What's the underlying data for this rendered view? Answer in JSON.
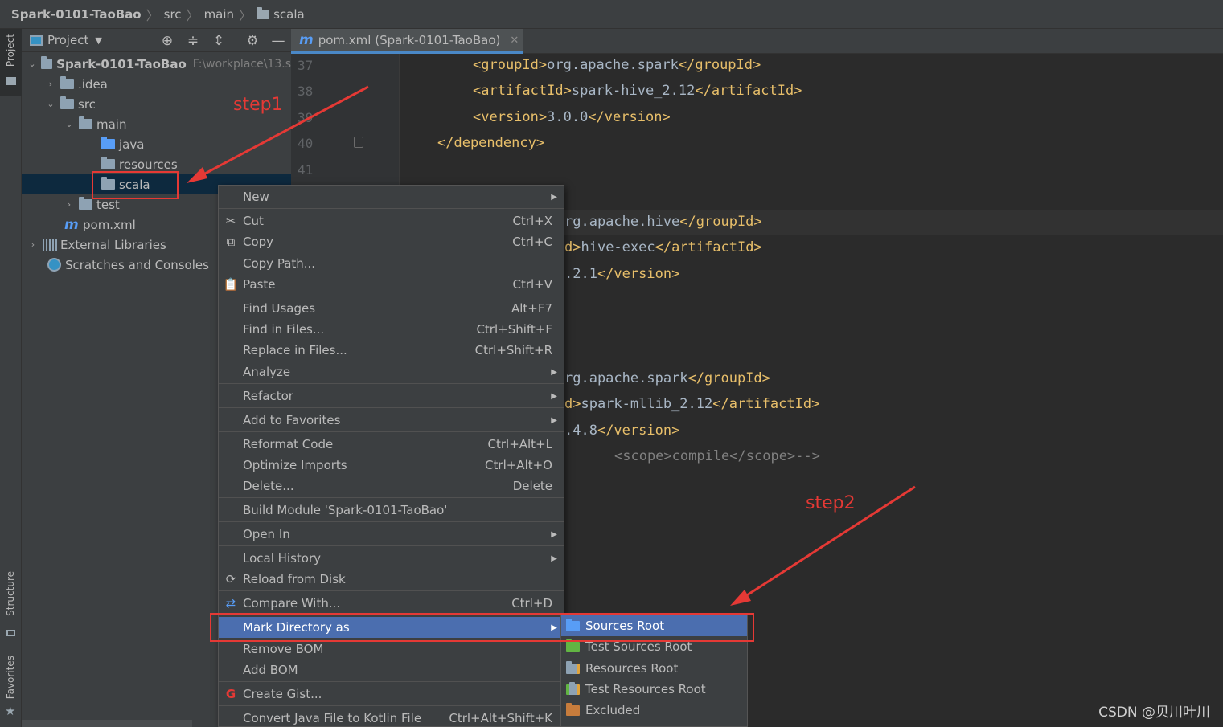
{
  "breadcrumb": {
    "project": "Spark-0101-TaoBao",
    "src": "src",
    "main": "main",
    "scala": "scala"
  },
  "stripe": {
    "project": "Project",
    "structure": "Structure",
    "favorites": "Favorites"
  },
  "project_panel": {
    "title": "Project",
    "tree": {
      "root": "Spark-0101-TaoBao",
      "root_path": "F:\\workplace\\13.s",
      "idea": ".idea",
      "src": "src",
      "main": "main",
      "java": "java",
      "resources": "resources",
      "scala": "scala",
      "test": "test",
      "pom": "pom.xml",
      "external_libraries": "External Libraries",
      "scratches": "Scratches and Consoles"
    }
  },
  "editor": {
    "tab": "pom.xml (Spark-0101-TaoBao)",
    "line_numbers": [
      "37",
      "38",
      "39",
      "40",
      "41"
    ],
    "code": {
      "l1_open": "<groupId>",
      "l1_val": "org.apache.spark",
      "l1_close": "</groupId>",
      "l2_open": "<artifactId>",
      "l2_val": "spark-hive_2.12",
      "l2_close": "</artifactId>",
      "l3_open": "<version>",
      "l3_val": "3.0.0",
      "l3_close": "</version>",
      "l4": "</dependency>",
      "l5_val": "rg.apache.hive",
      "l5_close": "</groupId>",
      "l6_pre": "d>",
      "l6_val": "hive-exec",
      "l6_close": "</artifactId>",
      "l7_val": ".2.1",
      "l7_close": "</version>",
      "l8_val": "rg.apache.spark",
      "l8_close": "</groupId>",
      "l9_pre": "d>",
      "l9_val": "spark-mllib_2.12",
      "l9_close": "</artifactId>",
      "l10_val": ".4.8",
      "l10_close": "</version>",
      "l11": "<scope>compile</scope>-->"
    }
  },
  "context_menu": {
    "new": "New",
    "cut": "Cut",
    "cut_sc": "Ctrl+X",
    "copy": "Copy",
    "copy_sc": "Ctrl+C",
    "copy_path": "Copy Path...",
    "paste": "Paste",
    "paste_sc": "Ctrl+V",
    "find_usages": "Find Usages",
    "find_usages_sc": "Alt+F7",
    "find_in_files": "Find in Files...",
    "find_in_files_sc": "Ctrl+Shift+F",
    "replace_in_files": "Replace in Files...",
    "replace_in_files_sc": "Ctrl+Shift+R",
    "analyze": "Analyze",
    "refactor": "Refactor",
    "add_to_favorites": "Add to Favorites",
    "reformat_code": "Reformat Code",
    "reformat_code_sc": "Ctrl+Alt+L",
    "optimize_imports": "Optimize Imports",
    "optimize_imports_sc": "Ctrl+Alt+O",
    "delete": "Delete...",
    "delete_sc": "Delete",
    "build_module": "Build Module 'Spark-0101-TaoBao'",
    "open_in": "Open In",
    "local_history": "Local History",
    "reload_from_disk": "Reload from Disk",
    "compare_with": "Compare With...",
    "compare_with_sc": "Ctrl+D",
    "mark_directory_as": "Mark Directory as",
    "remove_bom": "Remove BOM",
    "add_bom": "Add BOM",
    "create_gist": "Create Gist...",
    "convert_kotlin": "Convert Java File to Kotlin File",
    "convert_kotlin_sc": "Ctrl+Alt+Shift+K"
  },
  "submenu": {
    "sources_root": "Sources Root",
    "test_sources_root": "Test Sources Root",
    "resources_root": "Resources Root",
    "test_resources_root": "Test Resources Root",
    "excluded": "Excluded"
  },
  "annotations": {
    "step1": "step1",
    "step2": "step2"
  },
  "watermark": "CSDN @贝川叶川",
  "colors": {
    "selection": "#4b6eaf",
    "annotation": "#e53935",
    "xml_tag": "#e8bf6a"
  }
}
